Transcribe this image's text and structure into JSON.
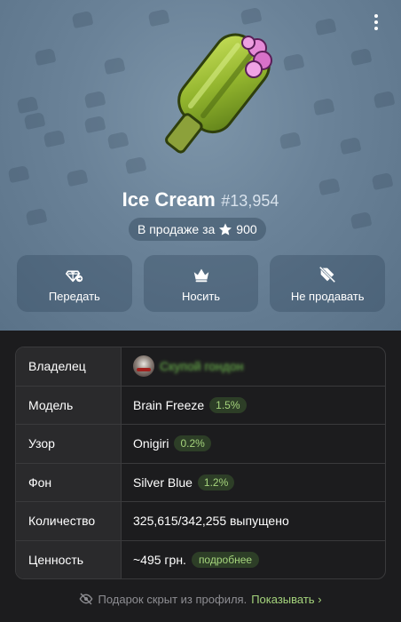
{
  "gift": {
    "name": "Ice Cream",
    "number": "#13,954",
    "sale_prefix": "В продаже за",
    "sale_price": "900"
  },
  "actions": [
    {
      "label": "Передать",
      "icon": "gift-transfer-icon"
    },
    {
      "label": "Носить",
      "icon": "crown-icon"
    },
    {
      "label": "Не продавать",
      "icon": "tag-off-icon"
    }
  ],
  "details": {
    "owner_label": "Владелец",
    "owner_name": "Скупой гондон",
    "model_label": "Модель",
    "model_value": "Brain Freeze",
    "model_pct": "1.5%",
    "pattern_label": "Узор",
    "pattern_value": "Onigiri",
    "pattern_pct": "0.2%",
    "background_label": "Фон",
    "background_value": "Silver Blue",
    "background_pct": "1.2%",
    "quantity_label": "Количество",
    "quantity_value": "325,615/342,255 выпущено",
    "value_label": "Ценность",
    "value_value": "~495 грн.",
    "value_more": "подробнее"
  },
  "footer": {
    "text": "Подарок скрыт из профиля.",
    "link": "Показывать"
  },
  "colors": {
    "hero_bg": "#6a8298",
    "accent_green": "#a5d47c",
    "page_bg": "#1c1c1e"
  }
}
